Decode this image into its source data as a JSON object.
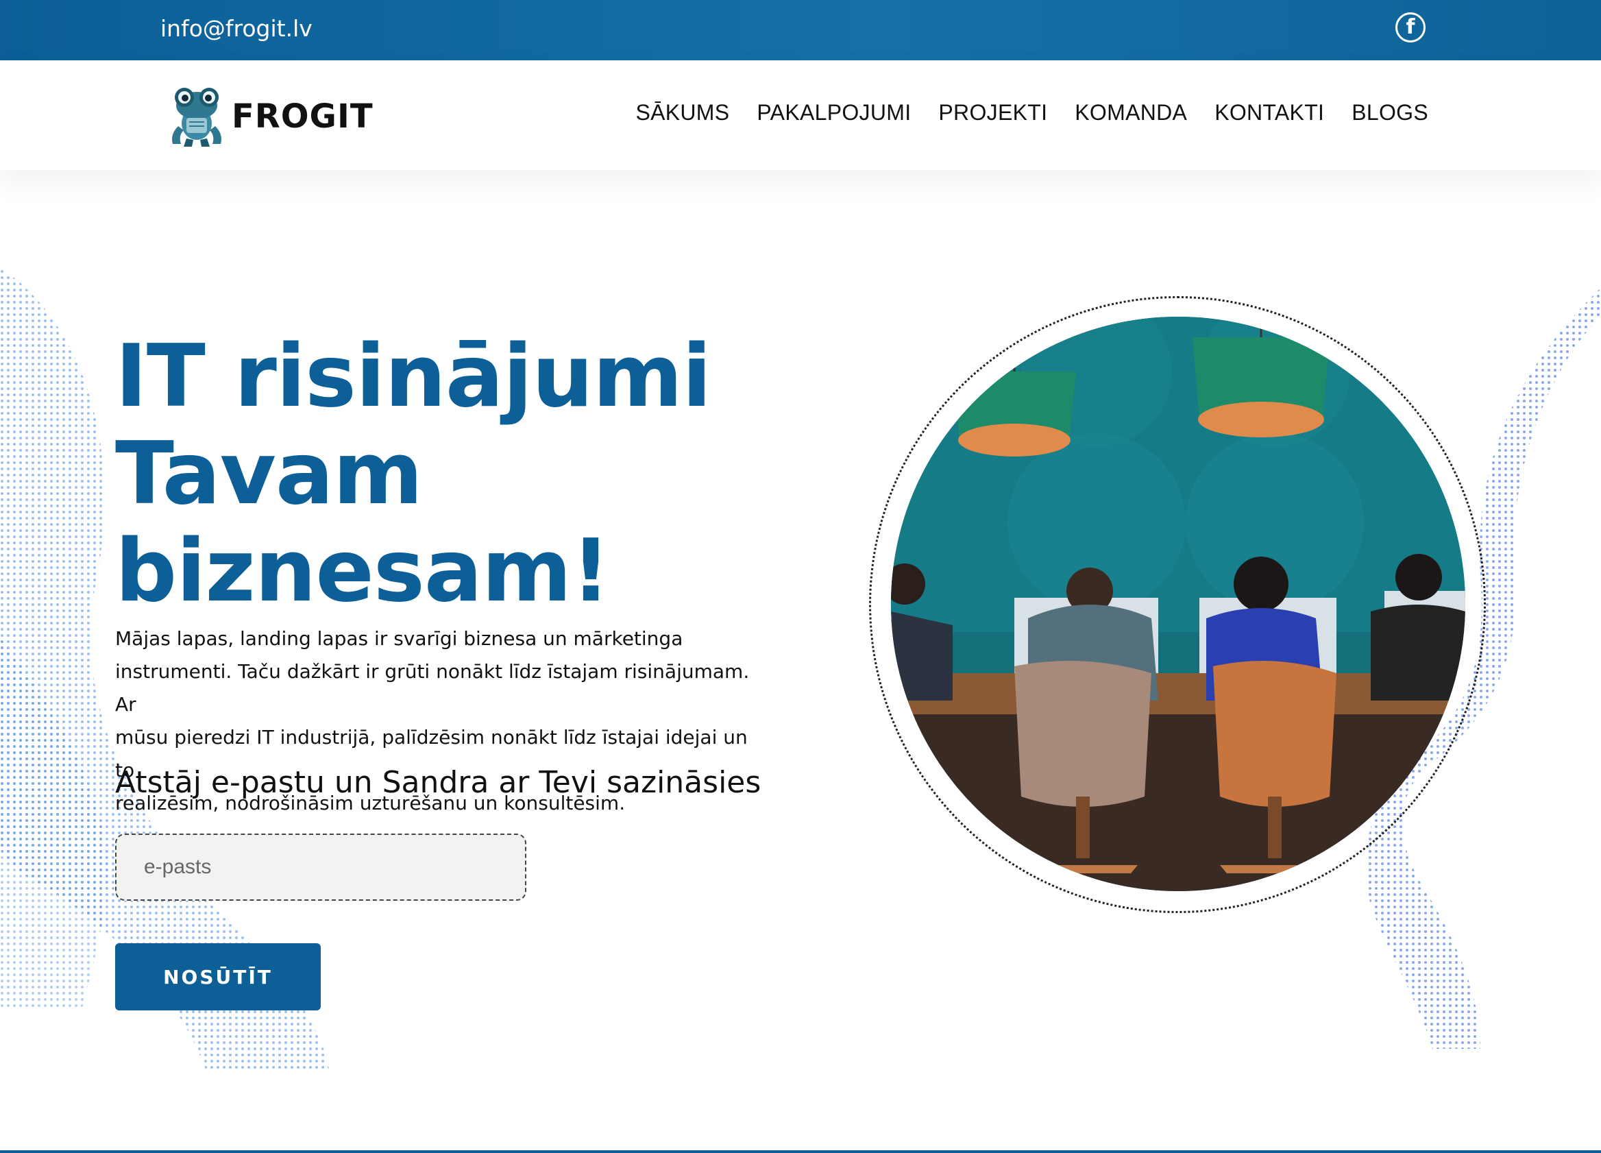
{
  "topbar": {
    "email": "info@frogit.lv",
    "social_icon": "facebook-icon",
    "social_glyph": "f"
  },
  "header": {
    "brand": "FROGIT",
    "logo_icon": "frog-robot-logo",
    "nav": [
      "SĀKUMS",
      "PAKALPOJUMI",
      "PROJEKTI",
      "KOMANDA",
      "KONTAKTI",
      "BLOGS"
    ]
  },
  "hero": {
    "title_line1": "IT risinājumi",
    "title_line2": "Tavam",
    "title_line3": "biznesam!",
    "text_line1": "Mājas lapas, landing lapas ir svarīgi biznesa un mārketinga",
    "text_line2": "instrumenti. Taču dažkārt ir grūti nonākt līdz īstajam risinājumam. Ar",
    "text_line3": "mūsu pieredzi IT industrijā, palīdzēsim nonākt līdz īstajai idejai un to",
    "text_line4": "realizēsim, nodrošināsim uzturēšanu un konsultēsim.",
    "cta_text": "Atstāj e-pastu un Sandra ar Tevi sazināsies",
    "email_placeholder": "e-pasts",
    "submit_label": "NOSŪTĪT"
  },
  "colors": {
    "brand_blue": "#0c5f97",
    "topbar_blue": "#1570a8",
    "wave_blue": "#3a7ee0"
  }
}
